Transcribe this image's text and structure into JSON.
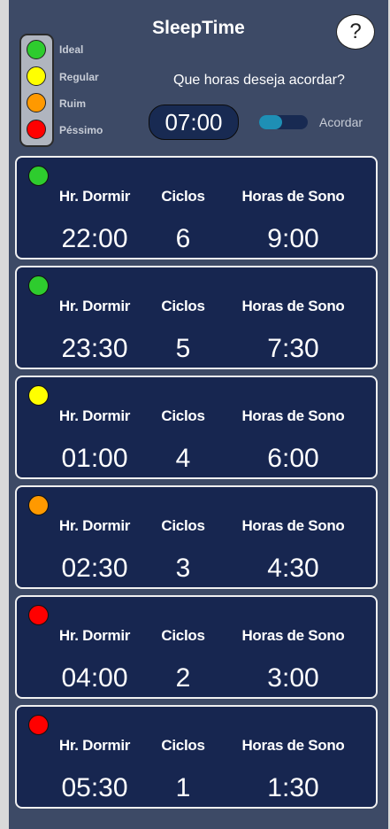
{
  "header": {
    "title": "SleepTime",
    "help_label": "?",
    "question": "Que horas deseja acordar?",
    "wake_time": "07:00",
    "toggle_label": "Acordar"
  },
  "legend": [
    {
      "label": "Ideal",
      "color": "#2ecc2e"
    },
    {
      "label": "Regular",
      "color": "#ffff00"
    },
    {
      "label": "Ruim",
      "color": "#ff9900"
    },
    {
      "label": "Péssimo",
      "color": "#ff0000"
    }
  ],
  "columns": {
    "sleep_time": "Hr. Dormir",
    "cycles": "Ciclos",
    "hours": "Horas de Sono"
  },
  "cards": [
    {
      "status_color": "#2ecc2e",
      "sleep_time": "22:00",
      "cycles": "6",
      "hours": "9:00"
    },
    {
      "status_color": "#2ecc2e",
      "sleep_time": "23:30",
      "cycles": "5",
      "hours": "7:30"
    },
    {
      "status_color": "#ffff00",
      "sleep_time": "01:00",
      "cycles": "4",
      "hours": "6:00"
    },
    {
      "status_color": "#ff9900",
      "sleep_time": "02:30",
      "cycles": "3",
      "hours": "4:30"
    },
    {
      "status_color": "#ff0000",
      "sleep_time": "04:00",
      "cycles": "2",
      "hours": "3:00"
    },
    {
      "status_color": "#ff0000",
      "sleep_time": "05:30",
      "cycles": "1",
      "hours": "1:30"
    }
  ]
}
